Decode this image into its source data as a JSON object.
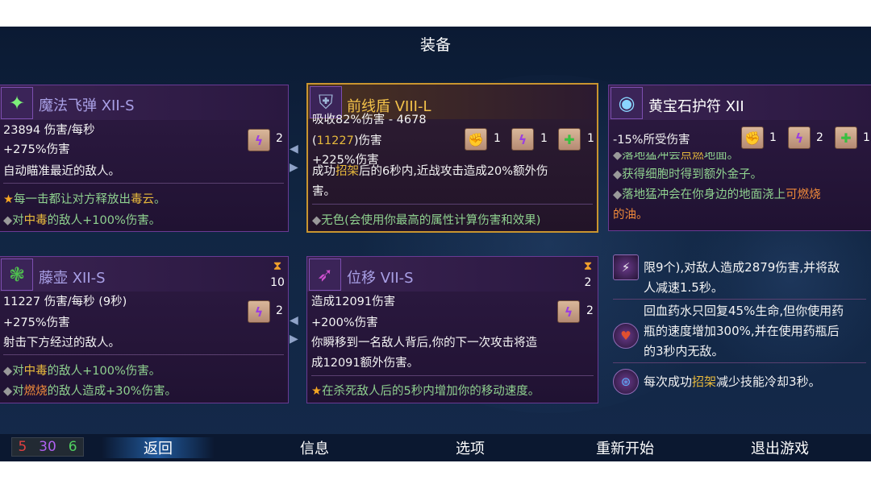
{
  "title": "装备",
  "stats": {
    "red": "5",
    "purple": "30",
    "green": "6"
  },
  "menu": {
    "back": "返回",
    "info": "信息",
    "options": "选项",
    "restart": "重新开始",
    "quit": "退出游戏"
  },
  "item1": {
    "name": "魔法飞弹 XII-S",
    "dps": "23894 伤害/每秒",
    "bonus": "+275%伤害",
    "scroll_count": "2",
    "desc": "自动瞄准最近的敌人。",
    "mod1_a": "每一击都让对方释放出",
    "mod1_b": "毒云",
    "mod1_c": "。",
    "mod2_a": "对",
    "mod2_b": "中毒",
    "mod2_c": "的敌人+100%伤害。"
  },
  "item2": {
    "name": "前线盾 VIII-L",
    "absorb": "吸收82%伤害 - 4678",
    "dmg_a": "(",
    "dmg_b": "11227",
    "dmg_c": ")伤害",
    "bonus": "+225%伤害",
    "scroll1": "1",
    "scroll2": "1",
    "scroll3": "1",
    "desc1_a": "成功",
    "desc1_b": "招架",
    "desc1_c": "后的6秒内,近战攻击造成20%额外伤",
    "desc2": "害。",
    "mod1": "无色(会使用你最高的属性计算伤害和效果)"
  },
  "item3": {
    "name": "黄宝石护符 XII",
    "stat": "-15%所受伤害",
    "scroll1": "1",
    "scroll2": "2",
    "scroll3": "1",
    "mod0_a": "落地猛冲会",
    "mod0_b": "点燃",
    "mod0_c": "地面。",
    "mod1": "获得细胞时得到额外金子。",
    "mod2_a": "落地猛冲会在你身边的地面浇上",
    "mod2_b": "可燃烧",
    "mod3": "的油。"
  },
  "item4": {
    "name": "藤壶 XII-S",
    "timer": "10",
    "dps": "11227 伤害/每秒 (9秒)",
    "bonus": "+275%伤害",
    "scroll_count": "2",
    "desc": "射击下方经过的敌人。",
    "mod1_a": "对",
    "mod1_b": "中毒",
    "mod1_c": "的敌人+100%伤害。",
    "mod2_a": "对",
    "mod2_b": "燃烧",
    "mod2_c": "的敌人造成+30%伤害。"
  },
  "item5": {
    "name": "位移 VII-S",
    "timer": "2",
    "dmg": "造成12091伤害",
    "bonus": "+200%伤害",
    "scroll_count": "2",
    "desc1": "你瞬移到一名敌人背后,你的下一次攻击将造",
    "desc2": "成12091额外伤害。",
    "mod1": "在杀死敌人后的5秒内增加你的移动速度。"
  },
  "mutations": {
    "m1_l1": "限9个),对敌人造成2879伤害,并将敌",
    "m1_l2": "人减速1.5秒。",
    "m2_l1": "回血药水只回复45%生命,但你使用药",
    "m2_l2": "瓶的速度增加300%,并在使用药瓶后",
    "m2_l3": "的3秒内无敌。",
    "m3_a": "每次成功",
    "m3_b": "招架",
    "m3_c": "减少技能冷却3秒。"
  }
}
